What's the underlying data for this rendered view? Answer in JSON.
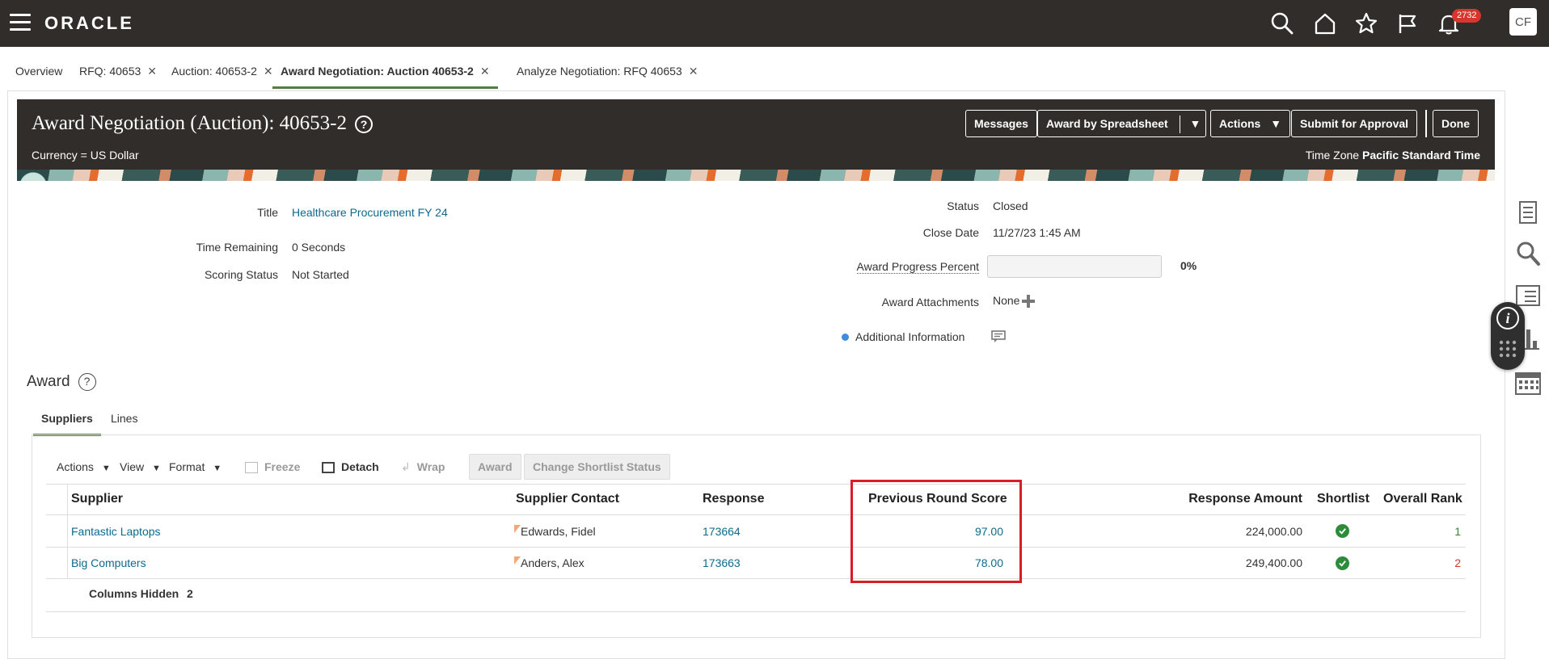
{
  "global_header": {
    "logo_text": "ORACLE",
    "notification_count": "2732",
    "user_initials": "CF",
    "icons": [
      "menu-icon",
      "search-icon",
      "home-icon",
      "star-icon",
      "flag-icon",
      "bell-icon"
    ]
  },
  "tabs": [
    {
      "label": "Overview",
      "closable": false
    },
    {
      "label": "RFQ: 40653",
      "closable": true
    },
    {
      "label": "Auction: 40653-2",
      "closable": true
    },
    {
      "label": "Award Negotiation: Auction 40653-2",
      "closable": true,
      "active": true
    },
    {
      "label": "Analyze Negotiation: RFQ 40653",
      "closable": true
    }
  ],
  "page_header": {
    "title": "Award Negotiation (Auction): 40653-2",
    "help": "?",
    "currency": "Currency = US Dollar",
    "timezone_label": "Time Zone",
    "timezone_value": "Pacific Standard Time",
    "buttons": {
      "messages": "Messages",
      "award_by_spreadsheet": "Award by Spreadsheet",
      "actions": "Actions",
      "submit": "Submit for Approval",
      "done": "Done"
    }
  },
  "details": {
    "title_label": "Title",
    "title_value": "Healthcare Procurement FY 24",
    "time_remaining_label": "Time Remaining",
    "time_remaining_value": "0 Seconds",
    "scoring_status_label": "Scoring Status",
    "scoring_status_value": "Not Started",
    "status_label": "Status",
    "status_value": "Closed",
    "close_date_label": "Close Date",
    "close_date_value": "11/27/23 1:45 AM",
    "award_progress_label": "Award Progress Percent",
    "award_progress_value": "0%",
    "award_progress_fraction": 0,
    "award_attachments_label": "Award Attachments",
    "award_attachments_value": "None",
    "additional_info_label": "Additional Information"
  },
  "award": {
    "heading": "Award",
    "subtabs": [
      "Suppliers",
      "Lines"
    ],
    "active_subtab": "Suppliers",
    "toolbar": {
      "actions": "Actions",
      "view": "View",
      "format": "Format",
      "freeze": "Freeze",
      "detach": "Detach",
      "wrap": "Wrap",
      "award_btn": "Award",
      "change_shortlist": "Change Shortlist Status"
    },
    "columns": {
      "supplier": "Supplier",
      "supplier_contact": "Supplier Contact",
      "response": "Response",
      "previous_round_score": "Previous Round Score",
      "response_amount": "Response Amount",
      "shortlist": "Shortlist",
      "overall_rank": "Overall Rank"
    },
    "rows": [
      {
        "supplier": "Fantastic Laptops",
        "contact": "Edwards, Fidel",
        "response": "173664",
        "score": "97.00",
        "amount": "224,000.00",
        "shortlisted": true,
        "rank": "1"
      },
      {
        "supplier": "Big Computers",
        "contact": "Anders, Alex",
        "response": "173663",
        "score": "78.00",
        "amount": "249,400.00",
        "shortlisted": true,
        "rank": "2"
      }
    ],
    "columns_hidden_label": "Columns Hidden",
    "columns_hidden_value": "2"
  },
  "colors": {
    "header_bg": "#312d2a",
    "link": "#0d6a8c",
    "tab_underline": "#567d43",
    "highlight": "#d71e26",
    "check": "#2e8b3a",
    "rank_2": "#d6362e",
    "rank_1": "#2e8b3a"
  }
}
